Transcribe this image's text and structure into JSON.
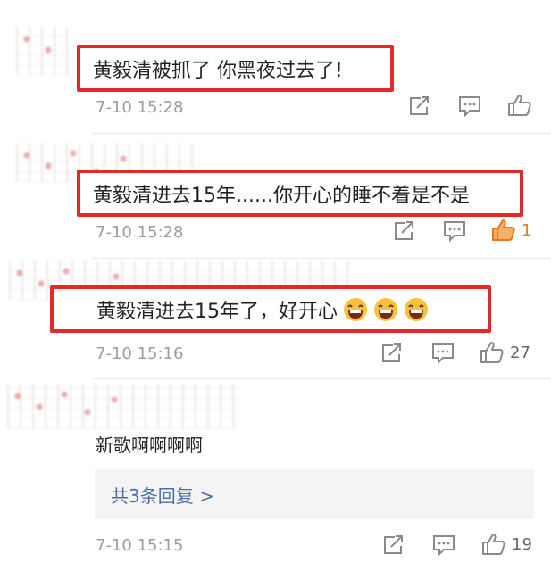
{
  "comments": [
    {
      "text": "黄毅清被抓了 你黑夜过去了!",
      "time": "7-10 15:28",
      "likes": ""
    },
    {
      "text": "黄毅清进去15年......你开心的睡不着是不是",
      "time": "7-10 15:28",
      "likes": "1"
    },
    {
      "text": "黄毅清进去15年了，好开心",
      "time": "7-10 15:16",
      "likes": "27"
    },
    {
      "text": "新歌啊啊啊啊",
      "time": "7-10 15:15",
      "likes": "19",
      "replies_label": "共3条回复 >"
    }
  ],
  "icons": [
    "share-icon",
    "comment-icon",
    "like-icon",
    "laugh-emoji-icon"
  ],
  "colors": {
    "highlight": "#e12b2b",
    "liked": "#e07a1f",
    "link": "#4a6fa5"
  }
}
